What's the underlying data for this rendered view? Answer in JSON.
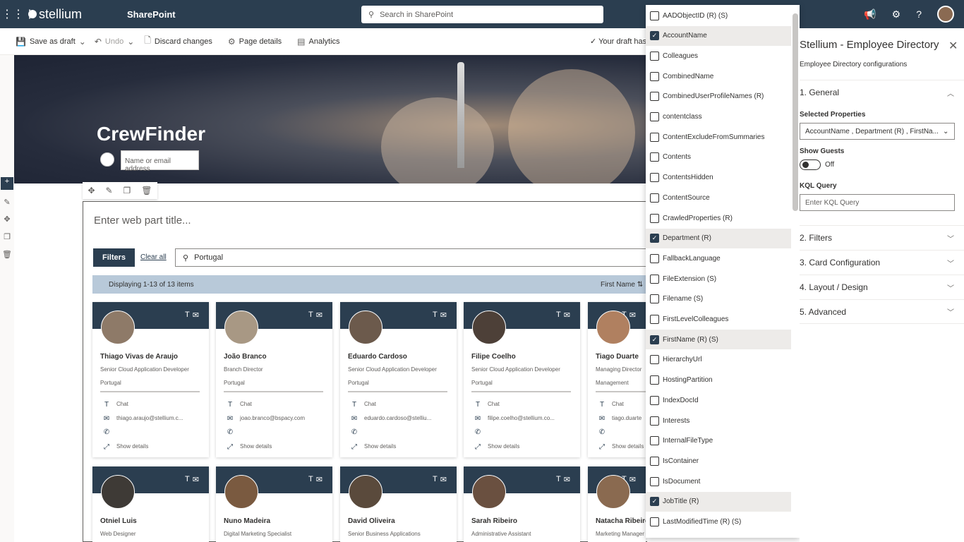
{
  "suite": {
    "brand": "stellium",
    "app": "SharePoint",
    "search_placeholder": "Search in SharePoint"
  },
  "commands": {
    "save_draft": "Save as draft",
    "undo": "Undo",
    "discard": "Discard changes",
    "page_details": "Page details",
    "analytics": "Analytics",
    "draft_status": "Your draft has"
  },
  "hero": {
    "title": "CrewFinder",
    "input_placeholder": "Name or email address"
  },
  "webpart": {
    "title_placeholder": "Enter web part title...",
    "filters_label": "Filters",
    "clear_all": "Clear all",
    "search_value": "Portugal",
    "displaying": "Displaying 1-13 of 13 items",
    "sort_label": "First Name"
  },
  "cards": [
    {
      "name": "Thiago Vivas de Araujo",
      "role": "Senior Cloud Application Developer",
      "dept": "Portugal",
      "chat": "Chat",
      "email": "thiago.araujo@stellium.c...",
      "details": "Show details",
      "avatar": "#8e7a68"
    },
    {
      "name": "João Branco",
      "role": "Branch Director",
      "dept": "Portugal",
      "chat": "Chat",
      "email": "joao.branco@bspacy.com",
      "details": "Show details",
      "avatar": "#a89884"
    },
    {
      "name": "Eduardo Cardoso",
      "role": "Senior Cloud Application Developer",
      "dept": "Portugal",
      "chat": "Chat",
      "email": "eduardo.cardoso@stelliu...",
      "details": "Show details",
      "avatar": "#6c5a4c"
    },
    {
      "name": "Filipe Coelho",
      "role": "Senior Cloud Application Developer",
      "dept": "Portugal",
      "chat": "Chat",
      "email": "filipe.coelho@stellium.co...",
      "details": "Show details",
      "avatar": "#4d4038"
    },
    {
      "name": "Tiago Duarte",
      "role": "Managing Director",
      "dept": "Management",
      "chat": "Chat",
      "email": "tiago.duarte",
      "details": "Show details",
      "avatar": "#b08060"
    },
    {
      "name": "Otniel Luis",
      "role": "Web Designer",
      "dept": "",
      "avatar": "#3e3a36"
    },
    {
      "name": "Nuno Madeira",
      "role": "Digital Marketing Specialist",
      "dept": "",
      "avatar": "#7a5a40"
    },
    {
      "name": "David Oliveira",
      "role": "Senior Business Applications",
      "dept": "",
      "avatar": "#5a4a3c"
    },
    {
      "name": "Sarah Ribeiro",
      "role": "Administrative Assistant",
      "dept": "",
      "avatar": "#6a5040"
    },
    {
      "name": "Natacha Ribeiro",
      "role": "Marketing Manager",
      "dept": "",
      "avatar": "#8a6a50"
    }
  ],
  "properties": [
    {
      "label": "AADObjectID (R) (S)",
      "checked": false
    },
    {
      "label": "AccountName",
      "checked": true
    },
    {
      "label": "Colleagues",
      "checked": false
    },
    {
      "label": "CombinedName",
      "checked": false
    },
    {
      "label": "CombinedUserProfileNames (R)",
      "checked": false
    },
    {
      "label": "contentclass",
      "checked": false
    },
    {
      "label": "ContentExcludeFromSummaries",
      "checked": false
    },
    {
      "label": "Contents",
      "checked": false
    },
    {
      "label": "ContentsHidden",
      "checked": false
    },
    {
      "label": "ContentSource",
      "checked": false
    },
    {
      "label": "CrawledProperties (R)",
      "checked": false
    },
    {
      "label": "Department (R)",
      "checked": true
    },
    {
      "label": "FallbackLanguage",
      "checked": false
    },
    {
      "label": "FileExtension (S)",
      "checked": false
    },
    {
      "label": "Filename (S)",
      "checked": false
    },
    {
      "label": "FirstLevelColleagues",
      "checked": false
    },
    {
      "label": "FirstName (R) (S)",
      "checked": true
    },
    {
      "label": "HierarchyUrl",
      "checked": false
    },
    {
      "label": "HostingPartition",
      "checked": false
    },
    {
      "label": "IndexDocId",
      "checked": false
    },
    {
      "label": "Interests",
      "checked": false
    },
    {
      "label": "InternalFileType",
      "checked": false
    },
    {
      "label": "IsContainer",
      "checked": false
    },
    {
      "label": "IsDocument",
      "checked": false
    },
    {
      "label": "JobTitle (R)",
      "checked": true
    },
    {
      "label": "LastModifiedTime (R) (S)",
      "checked": false
    }
  ],
  "panel": {
    "title": "Stellium - Employee Directory",
    "subtitle": "Employee Directory configurations",
    "general": "1. General",
    "selected_properties_label": "Selected Properties",
    "selected_properties_value": "AccountName , Department (R) , FirstNa...",
    "show_guests_label": "Show Guests",
    "show_guests_state": "Off",
    "kql_label": "KQL Query",
    "kql_placeholder": "Enter KQL Query",
    "filters": "2. Filters",
    "card_config": "3. Card Configuration",
    "layout": "4. Layout / Design",
    "advanced": "5. Advanced"
  }
}
